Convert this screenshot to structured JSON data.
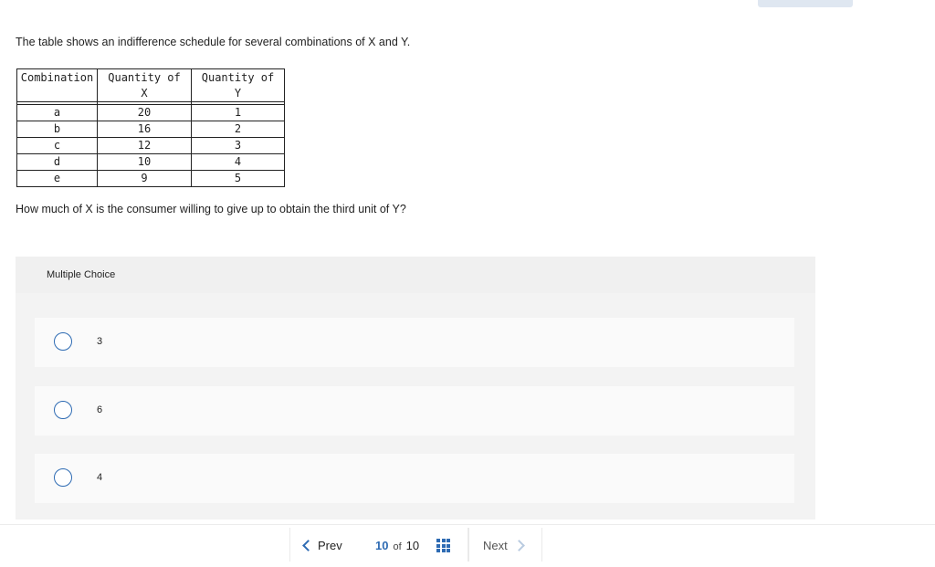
{
  "prompt": {
    "intro": "The table shows an indifference schedule for several combinations of X and Y.",
    "question": "How much of X is the consumer willing to give up to obtain the third unit of Y?"
  },
  "table": {
    "headers": {
      "combination": "Combination",
      "qx_line1": "Quantity of",
      "qx_line2": "X",
      "qy_line1": "Quantity of",
      "qy_line2": "Y"
    },
    "rows": [
      {
        "combination": "a",
        "x": "20",
        "y": "1"
      },
      {
        "combination": "b",
        "x": "16",
        "y": "2"
      },
      {
        "combination": "c",
        "x": "12",
        "y": "3"
      },
      {
        "combination": "d",
        "x": "10",
        "y": "4"
      },
      {
        "combination": "e",
        "x": "9",
        "y": "5"
      }
    ]
  },
  "multiple_choice": {
    "header": "Multiple Choice",
    "options": [
      {
        "label": "3",
        "icon": "radio-icon",
        "selected": false
      },
      {
        "label": "6",
        "icon": "radio-icon",
        "selected": false
      },
      {
        "label": "4",
        "icon": "radio-icon",
        "selected": false
      }
    ]
  },
  "footer": {
    "prev_label": "Prev",
    "next_label": "Next",
    "current_page": "10",
    "of_label": "of",
    "total_pages": "10",
    "prev_icon": "chevron-left-icon",
    "next_icon": "chevron-right-icon",
    "grid_icon": "grid-icon"
  },
  "colors": {
    "accent": "#2e6bb3",
    "panel_bg": "#f3f3f3",
    "option_bg": "#fafafa"
  }
}
